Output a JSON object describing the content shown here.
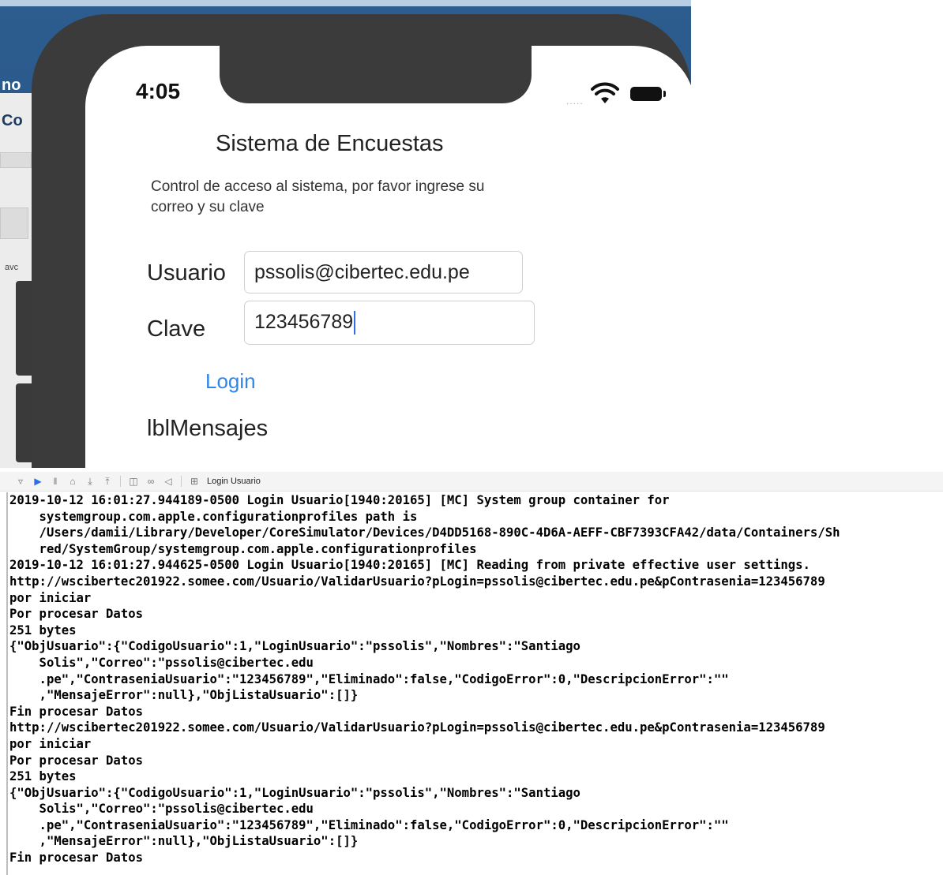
{
  "xcode_left": {
    "texts": [
      "no",
      "Co",
      "avc"
    ]
  },
  "simulator": {
    "status": {
      "time": "4:05",
      "signal_dots": ".....",
      "wifi_icon": "wifi-icon",
      "battery_icon": "battery-icon"
    },
    "app": {
      "title": "Sistema de Encuestas",
      "description": "Control de acceso al sistema, por favor ingrese su correo y su clave",
      "usuario_label": "Usuario",
      "usuario_value": "pssolis@cibertec.edu.pe",
      "clave_label": "Clave",
      "clave_value": "123456789",
      "login_label": "Login",
      "mensajes_label": "lblMensajes"
    },
    "accent_color": "#2f86e9"
  },
  "debug_toolbar": {
    "icons": [
      "hide-console-icon",
      "breakpoint-toggle-icon",
      "pause-icon",
      "step-over-icon",
      "step-into-icon",
      "step-out-icon",
      "view-debugger-icon",
      "memory-graph-icon",
      "location-icon",
      "process-icon"
    ],
    "target_label": "Login Usuario"
  },
  "console": {
    "lines": [
      "2019-10-12 16:01:27.944189-0500 Login Usuario[1940:20165] [MC] System group container for",
      "    systemgroup.com.apple.configurationprofiles path is",
      "    /Users/damii/Library/Developer/CoreSimulator/Devices/D4DD5168-890C-4D6A-AEFF-CBF7393CFA42/data/Containers/Sh",
      "    red/SystemGroup/systemgroup.com.apple.configurationprofiles",
      "2019-10-12 16:01:27.944625-0500 Login Usuario[1940:20165] [MC] Reading from private effective user settings.",
      "http://wscibertec201922.somee.com/Usuario/ValidarUsuario?pLogin=pssolis@cibertec.edu.pe&pContrasenia=123456789",
      "por iniciar",
      "Por procesar Datos",
      "251 bytes",
      "{\"ObjUsuario\":{\"CodigoUsuario\":1,\"LoginUsuario\":\"pssolis\",\"Nombres\":\"Santiago",
      "    Solis\",\"Correo\":\"pssolis@cibertec.edu",
      "    .pe\",\"ContraseniaUsuario\":\"123456789\",\"Eliminado\":false,\"CodigoError\":0,\"DescripcionError\":\"\"",
      "    ,\"MensajeError\":null},\"ObjListaUsuario\":[]}",
      "Fin procesar Datos",
      "http://wscibertec201922.somee.com/Usuario/ValidarUsuario?pLogin=pssolis@cibertec.edu.pe&pContrasenia=123456789",
      "por iniciar",
      "Por procesar Datos",
      "251 bytes",
      "{\"ObjUsuario\":{\"CodigoUsuario\":1,\"LoginUsuario\":\"pssolis\",\"Nombres\":\"Santiago",
      "    Solis\",\"Correo\":\"pssolis@cibertec.edu",
      "    .pe\",\"ContraseniaUsuario\":\"123456789\",\"Eliminado\":false,\"CodigoError\":0,\"DescripcionError\":\"\"",
      "    ,\"MensajeError\":null},\"ObjListaUsuario\":[]}",
      "Fin procesar Datos"
    ]
  }
}
